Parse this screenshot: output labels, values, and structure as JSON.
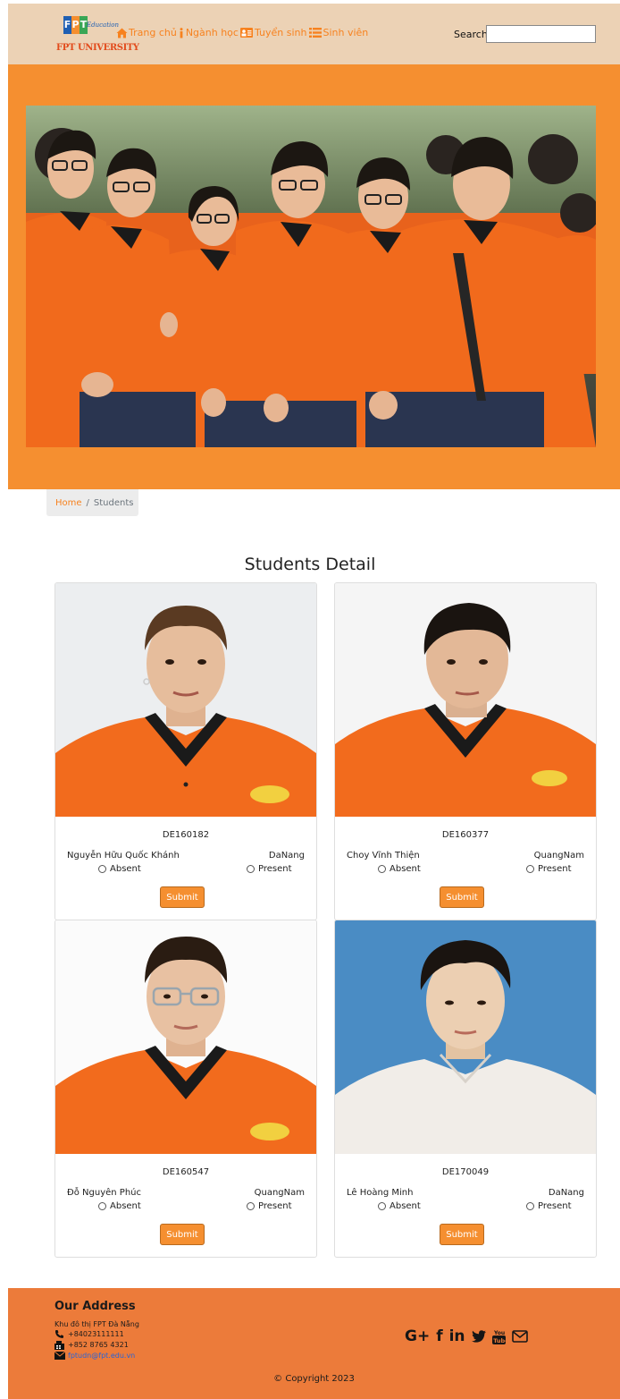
{
  "header": {
    "logo": {
      "mark": "FPT",
      "edu": "Education",
      "name": "FPT UNIVERSITY"
    },
    "nav": [
      {
        "label": "Trang chủ",
        "icon": "home-icon"
      },
      {
        "label": "Ngành học",
        "icon": "info-icon"
      },
      {
        "label": "Tuyển sinh",
        "icon": "id-card-icon"
      },
      {
        "label": "Sinh viên",
        "icon": "list-icon"
      }
    ],
    "search": {
      "label": "Search:",
      "value": "",
      "placeholder": ""
    }
  },
  "breadcrumb": {
    "home": "Home",
    "separator": "/",
    "current": "Students"
  },
  "main": {
    "title": "Students Detail",
    "students": [
      {
        "id": "DE160182",
        "name": "Nguyễn Hữu Quốc Khánh",
        "city": "DaNang",
        "absent_label": "Absent",
        "present_label": "Present",
        "submit_label": "Submit"
      },
      {
        "id": "DE160377",
        "name": "Choy Vĩnh Thiện",
        "city": "QuangNam",
        "absent_label": "Absent",
        "present_label": "Present",
        "submit_label": "Submit"
      },
      {
        "id": "DE160547",
        "name": "Đỗ Nguyên Phúc",
        "city": "QuangNam",
        "absent_label": "Absent",
        "present_label": "Present",
        "submit_label": "Submit"
      },
      {
        "id": "DE170049",
        "name": "Lê Hoàng Minh",
        "city": "DaNang",
        "absent_label": "Absent",
        "present_label": "Present",
        "submit_label": "Submit"
      }
    ]
  },
  "footer": {
    "title": "Our Address",
    "address": "Khu đô thị FPT Đà Nẵng",
    "phone": "+84023111111",
    "fax": "+852 8765 4321",
    "email": "fptudn@fpt.edu.vn",
    "social": [
      "google-plus-icon",
      "facebook-icon",
      "linkedin-icon",
      "twitter-icon",
      "youtube-icon",
      "mail-icon"
    ],
    "social_text": {
      "google": "G+",
      "facebook": "f",
      "linkedin": "in"
    },
    "copyright": "© Copyright 2023"
  },
  "colors": {
    "header_bg": "#ecd2b5",
    "accent": "#f58f30",
    "link": "#f7821f",
    "footer_bg": "#ec7b3a"
  }
}
